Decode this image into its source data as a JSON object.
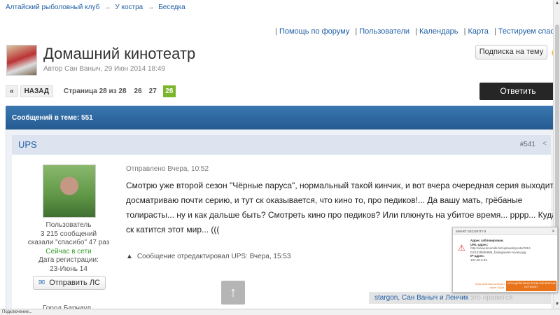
{
  "breadcrumb": {
    "items": [
      "Алтайский рыболовный клуб",
      "У костра",
      "Беседка"
    ],
    "separator": "→"
  },
  "topnav": {
    "items": [
      "Помощь по форуму",
      "Пользователи",
      "Календарь",
      "Карта",
      "Тестируем спасе"
    ]
  },
  "topic": {
    "title": "Домашний кинотеатр",
    "meta": "Автор Сан Ваныч, 29 Июн 2014 18:49",
    "subscribe_label": "Подписка на тему"
  },
  "pager": {
    "prev_label": "«",
    "back_label": "НАЗАД",
    "page_text": "Страница 28 из 28",
    "pages": [
      "26",
      "27"
    ],
    "current": "28"
  },
  "reply_label": "Ответить",
  "posts_header": "Сообщений в теме: 551",
  "post": {
    "author": "UPS",
    "number": "#541",
    "role": "Пользователь",
    "messages": "3 215 сообщений",
    "thanks": "сказали \"спасибо\" 47 раз",
    "status": "Сейчас в сети",
    "reg_label": "Дата регистрации:",
    "reg_date": "23-Июнь 14",
    "pm_label": "Отправить ЛС",
    "city": "Город Барнаул",
    "date": "Отправлено Вчера, 10:52",
    "text": "Смотрю уже второй сезон \"Чёрные паруса\", нормальный такой кинчик, и вот вчера очередная серия выходит, досматриваю почти серию, и тут ск оказывается, что кино то, про педиков!... Да вашу мать, грёбаные толирасты... ну и как дальше быть? Смотреть кино про педиков? Или плюнуть на убитое время... рррр... Куда ск катится этот мир... (((",
    "edit_note": "Сообщение отредактировал UPS: Вчера, 15:53",
    "thanks_users": "stargon, Сан Ваныч и Ленчик",
    "thanks_suffix": "это нравится"
  },
  "statusbar": "Подключение...",
  "eset": {
    "title": "SMART SECURITY 9",
    "heading": "Адрес заблокирован.",
    "url_label": "URL-адрес:",
    "url": "http://www.kinomilk.biz/uploads/posts/2012-02/1328936888_fradegander-review.jpg",
    "ip_label": "IP-адрес:",
    "ip": "104.28.0.83",
    "action_link": "Срок действия истекает через 15 дн.",
    "action_btn": "СРОК ДЕЙСТВИЯ ПРОБНОЙ ВЕРСИИ ИСТЕКАЕТ"
  },
  "colors": {
    "accent_blue": "#245a8f",
    "link": "#1f5fa6",
    "page_green": "#7ab52c",
    "online_green": "#3aa02e",
    "eset_orange": "#e8731a"
  }
}
